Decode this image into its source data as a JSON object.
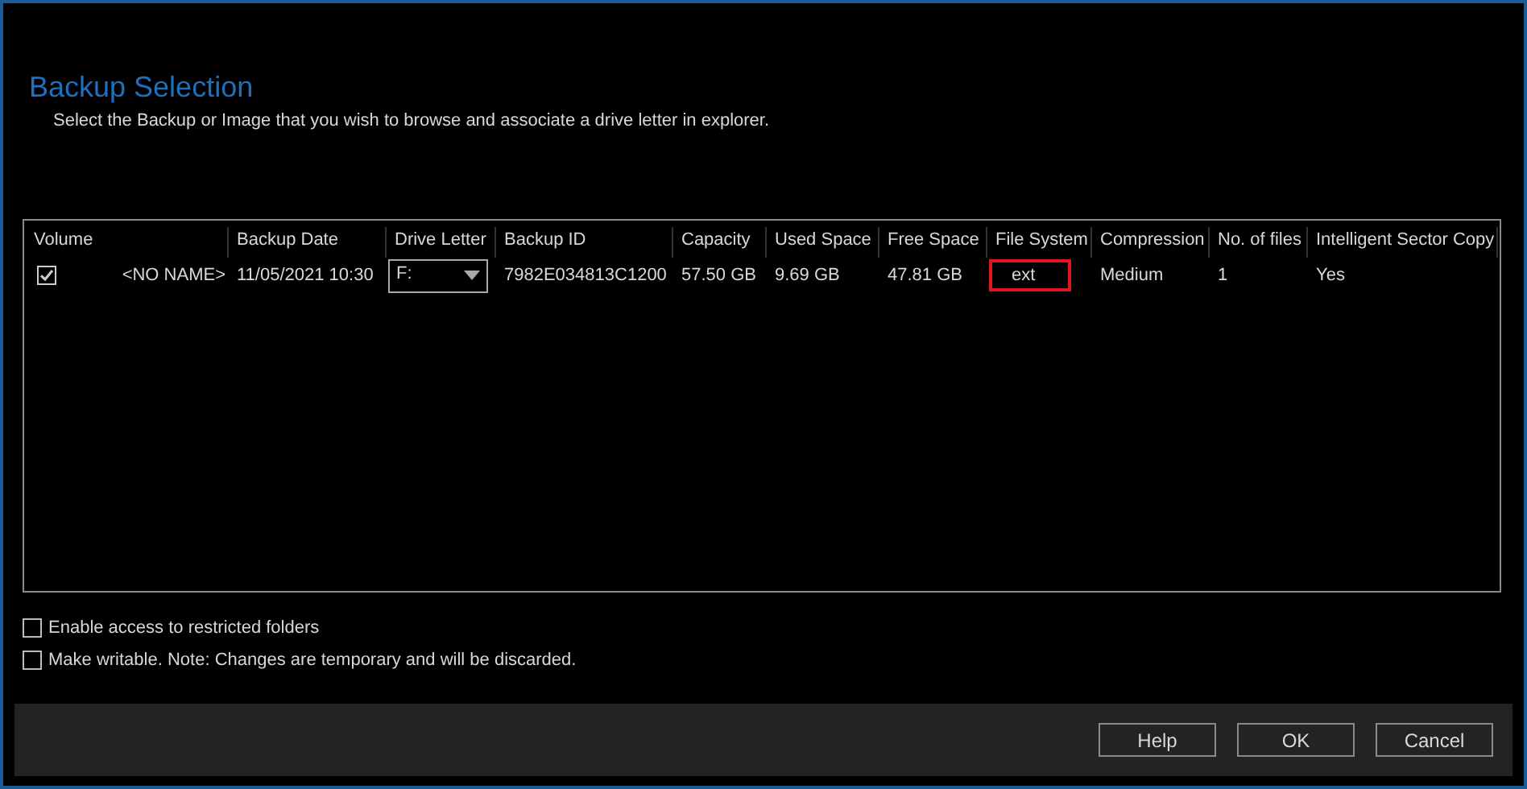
{
  "title": "Backup Selection",
  "subtitle": "Select the Backup or Image that you wish to browse and associate a drive letter in explorer.",
  "table": {
    "columns": [
      "Volume",
      "Backup Date",
      "Drive Letter",
      "Backup ID",
      "Capacity",
      "Used Space",
      "Free Space",
      "File System",
      "Compression",
      "No. of files",
      "Intelligent Sector Copy"
    ],
    "rows": [
      {
        "checked": true,
        "cells": [
          {
            "kind": "volume",
            "text": "<NO NAME>"
          },
          {
            "kind": "text",
            "text": "11/05/2021 10:30"
          },
          {
            "kind": "dropdown",
            "text": "F:"
          },
          {
            "kind": "text",
            "text": "7982E034813C1200"
          },
          {
            "kind": "text",
            "text": "57.50 GB"
          },
          {
            "kind": "text",
            "text": "9.69 GB"
          },
          {
            "kind": "text",
            "text": "47.81 GB"
          },
          {
            "kind": "boxed",
            "text": "ext"
          },
          {
            "kind": "text",
            "text": "Medium"
          },
          {
            "kind": "text",
            "text": "1"
          },
          {
            "kind": "text",
            "text": "Yes"
          }
        ]
      }
    ]
  },
  "options": [
    {
      "label": "Enable access to restricted folders",
      "checked": false
    },
    {
      "label": "Make writable. Note: Changes are temporary and will be discarded.",
      "checked": false
    }
  ],
  "buttons": [
    "Help",
    "OK",
    "Cancel"
  ]
}
